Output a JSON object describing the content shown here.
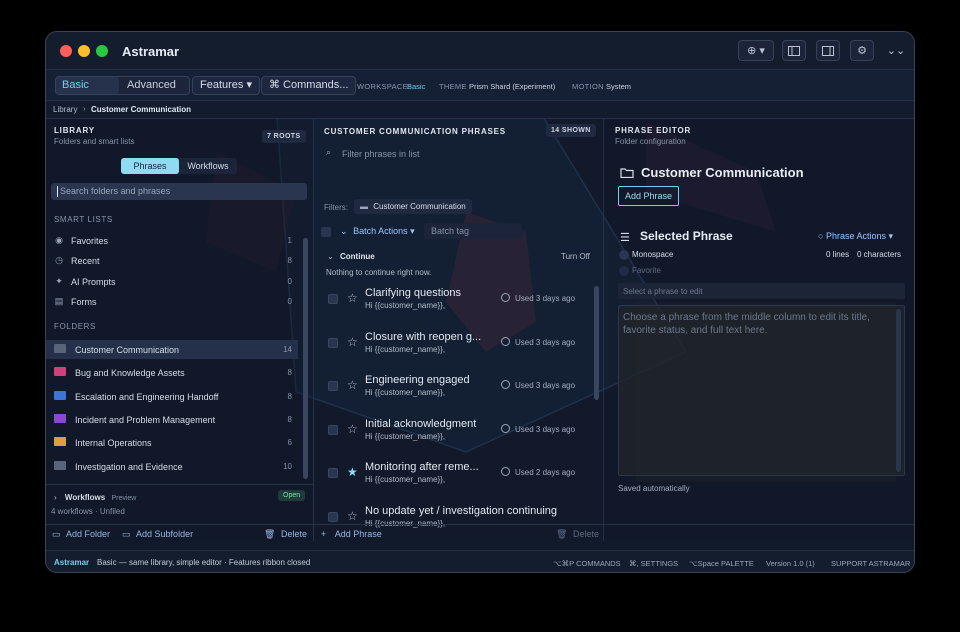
{
  "app": {
    "title": "Astramar",
    "window_controls": [
      "close",
      "minimize",
      "zoom"
    ],
    "toolbar_icons": [
      "add-circle-icon",
      "sidebar-left-icon",
      "sidebar-right-icon",
      "gear-icon",
      "chevron-down-icon"
    ]
  },
  "ribbon": {
    "mode_basic": "Basic",
    "mode_advanced": "Advanced",
    "selected_mode": "Basic",
    "features_label": "Features",
    "commands_label": "⌘ Commands...",
    "workspace_label": "WORKSPACE",
    "workspace_value": "Basic",
    "theme_label": "THEME",
    "theme_value": "Prism Shard (Experiment)",
    "motion_label": "MOTION",
    "motion_value": "System"
  },
  "breadcrumb": {
    "root": "Library",
    "separator": "›",
    "current": "Customer Communication"
  },
  "library": {
    "heading": "LIBRARY",
    "subheading": "Folders and smart lists",
    "roots_badge": "7 ROOTS",
    "tab_phrases": "Phrases",
    "tab_workflows": "Workflows",
    "search_placeholder": "Search folders and phrases",
    "smart_lists_title": "SMART LISTS",
    "smart_lists": [
      {
        "label": "Favorites",
        "count": "1",
        "icon": "star-circle-icon"
      },
      {
        "label": "Recent",
        "count": "8",
        "icon": "clock-icon"
      },
      {
        "label": "AI Prompts",
        "count": "0",
        "icon": "sparkle-icon"
      },
      {
        "label": "Forms",
        "count": "0",
        "icon": "form-icon"
      }
    ],
    "folders_title": "FOLDERS",
    "folders": [
      {
        "label": "Customer Communication",
        "count": "14",
        "color": "#5a6478"
      },
      {
        "label": "Bug and Knowledge Assets",
        "count": "8",
        "color": "#d0407a"
      },
      {
        "label": "Escalation and Engineering Handoff",
        "count": "8",
        "color": "#3d74d6"
      },
      {
        "label": "Incident and Problem Management",
        "count": "8",
        "color": "#8a47d2"
      },
      {
        "label": "Internal Operations",
        "count": "6",
        "color": "#d6a23a"
      },
      {
        "label": "Investigation and Evidence",
        "count": "10",
        "color": "#5a6478"
      }
    ],
    "workflows_label": "Workflows",
    "workflows_tag": "Preview",
    "workflows_badge": "Open",
    "workflows_meta": "4 workflows · Unfiled",
    "add_folder": "Add Folder",
    "add_subfolder": "Add Subfolder",
    "delete": "Delete"
  },
  "phrases": {
    "heading": "CUSTOMER COMMUNICATION PHRASES",
    "shown_badge": "14 SHOWN",
    "filter_placeholder": "Filter phrases in list",
    "filters_label": "Filters:",
    "filter_chip": "Customer Communication",
    "batch_actions": "Batch Actions",
    "batch_tag_placeholder": "Batch tag",
    "continue_title": "Continue",
    "turn_off": "Turn Off",
    "continue_empty": "Nothing to continue right now.",
    "items": [
      {
        "title": "Clarifying questions",
        "snippet": "Hi {{customer_name}},",
        "used": "Used 3 days ago",
        "favorite": false
      },
      {
        "title": "Closure with reopen g...",
        "snippet": "Hi {{customer_name}},",
        "used": "Used 3 days ago",
        "favorite": false
      },
      {
        "title": "Engineering engaged",
        "snippet": "Hi {{customer_name}},",
        "used": "Used 3 days ago",
        "favorite": false
      },
      {
        "title": "Initial acknowledgment",
        "snippet": "Hi {{customer_name}},",
        "used": "Used 3 days ago",
        "favorite": false
      },
      {
        "title": "Monitoring after reme...",
        "snippet": "Hi {{customer_name}},",
        "used": "Used 2 days ago",
        "favorite": true
      },
      {
        "title": "No update yet / investigation continuing",
        "snippet": "Hi {{customer_name}},",
        "used": "",
        "favorite": false
      }
    ],
    "add_phrase": "Add Phrase",
    "delete": "Delete"
  },
  "editor": {
    "heading": "PHRASE EDITOR",
    "subheading": "Folder configuration",
    "folder_title": "Customer Communication",
    "add_phrase": "Add Phrase",
    "selected_title": "Selected Phrase",
    "phrase_actions": "Phrase Actions",
    "monospace_label": "Monospace",
    "lines": "0 lines",
    "characters": "0 characters",
    "favorite_label": "Favorite",
    "title_placeholder": "Select a phrase to edit",
    "body_placeholder": "Choose a phrase from the middle column to edit its title, favorite status, and full text here.",
    "saved": "Saved automatically"
  },
  "statusbar": {
    "brand": "Astramar",
    "message": "Basic — same library, simple editor · Features ribbon closed",
    "commands": "⌥⌘P COMMANDS",
    "settings": "⌘, SETTINGS",
    "palette": "⌥Space PALETTE",
    "version": "Version 1.0 (1)",
    "support": "SUPPORT ASTRAMAR"
  },
  "colors": {
    "accent": "#6fd0ee",
    "link": "#9bc4ff",
    "background": "#111a2b"
  }
}
